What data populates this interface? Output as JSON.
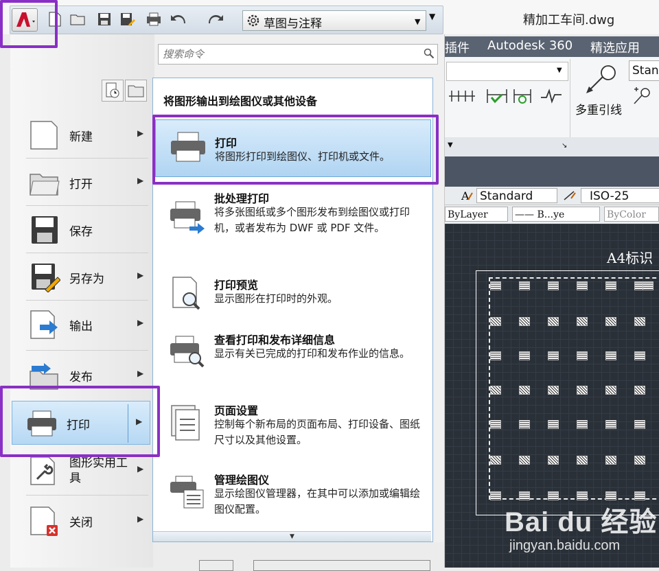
{
  "window": {
    "title": "精加工车间.dwg"
  },
  "quick_access": {
    "workspace": "草图与注释",
    "icons": [
      "autocad-logo-icon",
      "new-icon",
      "open-icon",
      "save-icon",
      "saveas-icon",
      "plot-icon",
      "undo-icon",
      "redo-icon"
    ]
  },
  "ribbon": {
    "tabs": [
      "插件",
      "Autodesk 360",
      "精选应用"
    ],
    "multileader_label": "多重引线",
    "text_style": "Stan"
  },
  "properties_toolbar": {
    "text_style": "Standard",
    "dim_style": "ISO-25",
    "layer": "ByLayer",
    "linetype": "—— B...ye",
    "color": "ByColor"
  },
  "drawing": {
    "title": "A4标识"
  },
  "app_menu": {
    "search_placeholder": "搜索命令",
    "items": [
      {
        "label": "新建",
        "icon": "new-document-icon"
      },
      {
        "label": "打开",
        "icon": "open-folder-icon"
      },
      {
        "label": "保存",
        "icon": "save-disk-icon"
      },
      {
        "label": "另存为",
        "icon": "save-as-icon"
      },
      {
        "label": "输出",
        "icon": "export-icon"
      },
      {
        "label": "发布",
        "icon": "publish-icon"
      },
      {
        "label": "打印",
        "icon": "printer-icon"
      },
      {
        "label": "图形实用工具",
        "icon": "wrench-icon"
      },
      {
        "label": "关闭",
        "icon": "close-document-icon"
      }
    ]
  },
  "submenu": {
    "header": "将图形输出到绘图仪或其他设备",
    "items": [
      {
        "title": "打印",
        "desc": "将图形打印到绘图仪、打印机或文件。"
      },
      {
        "title": "批处理打印",
        "desc": "将多张图纸或多个图形发布到绘图仪或打印机，或者发布为 DWF 或 PDF 文件。"
      },
      {
        "title": "打印预览",
        "desc": "显示图形在打印时的外观。"
      },
      {
        "title": "查看打印和发布详细信息",
        "desc": "显示有关已完成的打印和发布作业的信息。"
      },
      {
        "title": "页面设置",
        "desc": "控制每个新布局的页面布局、打印设备、图纸尺寸以及其他设置。"
      },
      {
        "title": "管理绘图仪",
        "desc": "显示绘图仪管理器，在其中可以添加或编辑绘图仪配置。"
      }
    ]
  },
  "watermark": {
    "text": "Bai du 经验",
    "url": "jingyan.baidu.com"
  },
  "colors": {
    "highlight": "#8a2fc5",
    "selection": "#b6d8f3",
    "canvas": "#2a3038",
    "ribbon_tab": "#5a6371"
  }
}
